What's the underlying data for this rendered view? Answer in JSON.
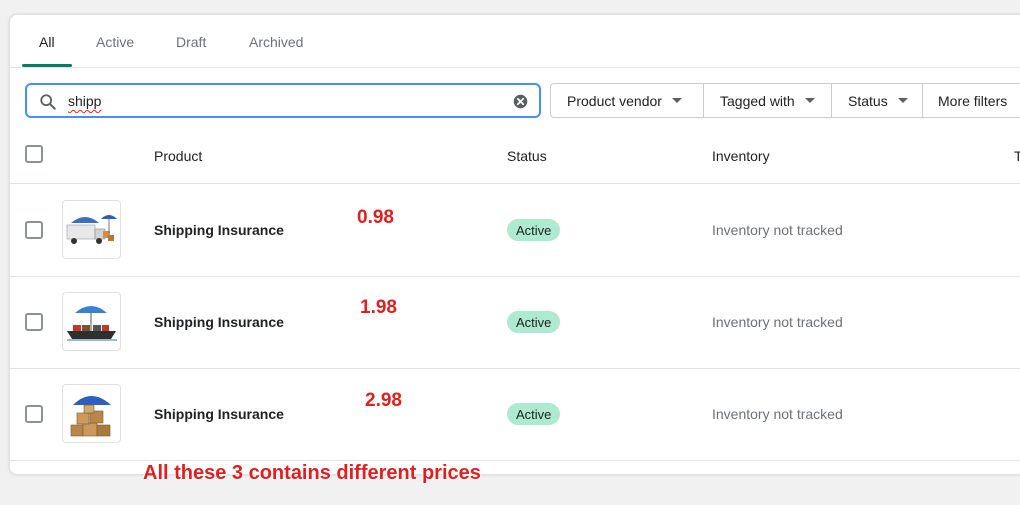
{
  "tabs": [
    {
      "label": "All",
      "selected": true
    },
    {
      "label": "Active",
      "selected": false
    },
    {
      "label": "Draft",
      "selected": false
    },
    {
      "label": "Archived",
      "selected": false
    }
  ],
  "search": {
    "value": "shipp"
  },
  "filters": {
    "product_vendor": "Product vendor",
    "tagged_with": "Tagged with",
    "status": "Status",
    "more_filters": "More filters"
  },
  "table": {
    "columns": {
      "product": "Product",
      "status": "Status",
      "inventory": "Inventory",
      "type_partial": "T"
    },
    "rows": [
      {
        "name": "Shipping Insurance",
        "status": "Active",
        "inventory": "Inventory not tracked",
        "price_annotation": "0.98",
        "thumbnail": "truck-umbrella-image"
      },
      {
        "name": "Shipping Insurance",
        "status": "Active",
        "inventory": "Inventory not tracked",
        "price_annotation": "1.98",
        "thumbnail": "ship-umbrella-image"
      },
      {
        "name": "Shipping Insurance",
        "status": "Active",
        "inventory": "Inventory not tracked",
        "price_annotation": "2.98",
        "thumbnail": "boxes-umbrella-image"
      }
    ]
  },
  "annotation": {
    "note": "All these 3 contains different prices",
    "color": "#e02020"
  },
  "colors": {
    "accent": "#008060",
    "badge_active": "#aee9d1",
    "focus": "#458fff"
  }
}
